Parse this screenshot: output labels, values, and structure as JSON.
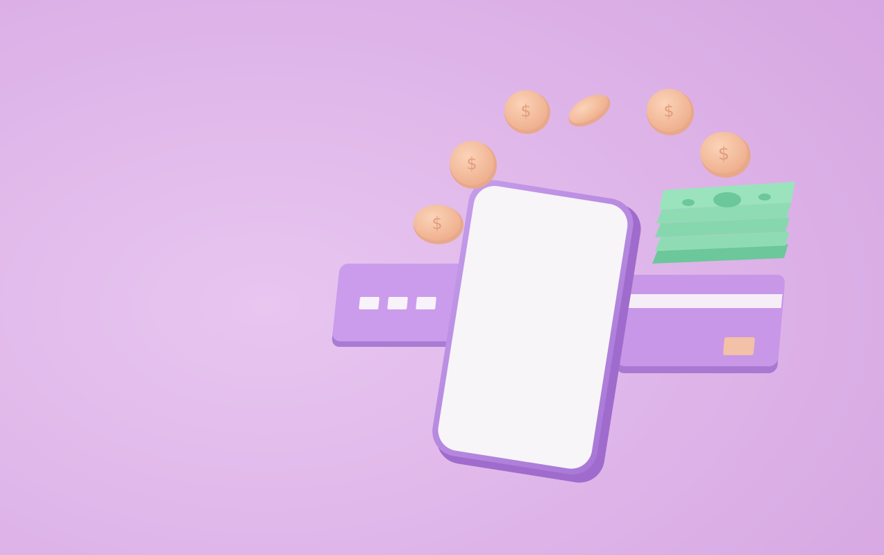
{
  "scene": {
    "subject": "smartphone-with-credit-cards-coins-and-cash",
    "colors": {
      "background_light": "#e6c0ee",
      "background_dark": "#d7a7e3",
      "phone_body": "#b98ae0",
      "phone_screen": "#f7f5f8",
      "card": "#c99aea",
      "card_stripe": "#f5eef7",
      "card_chip": "#f3c0a8",
      "coin": "#f6c3a3",
      "coin_edge": "#e8a88a",
      "cash": "#8fdcb4",
      "cash_dark": "#6cc79b"
    },
    "icons": [
      "smartphone-icon",
      "credit-card-icon",
      "coin-dollar-icon",
      "cash-stack-icon"
    ]
  }
}
